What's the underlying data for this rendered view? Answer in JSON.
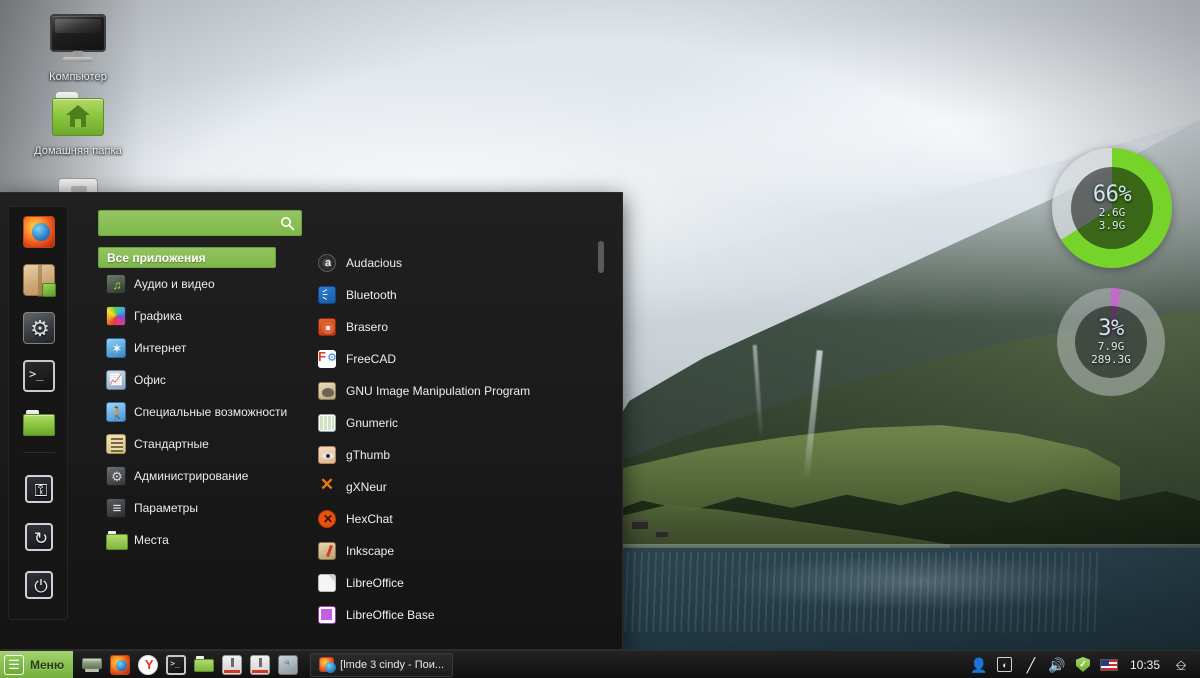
{
  "desktop": {
    "icons": [
      {
        "name": "computer",
        "label": "Компьютер",
        "icon": "monitor-icon"
      },
      {
        "name": "home-folder",
        "label": "Домашняя папка",
        "icon": "folder-home-icon"
      },
      {
        "name": "drive",
        "label": "",
        "icon": "drive-icon"
      }
    ],
    "gauges": [
      {
        "name": "memory-gauge",
        "percent": "66%",
        "used": "2.6G",
        "total": "3.9G",
        "value": 66,
        "color": "#76d329",
        "track": "#d8dcde"
      },
      {
        "name": "disk-gauge",
        "percent": "3%",
        "used": "7.9G",
        "total": "289.3G",
        "value": 3,
        "color": "#c06bc9",
        "track": "#b9bdbe"
      }
    ]
  },
  "menu": {
    "search": {
      "value": "",
      "placeholder": "",
      "icon": "search-icon"
    },
    "sidebar": [
      {
        "name": "firefox",
        "icon": "firefox-icon"
      },
      {
        "name": "software-manager",
        "icon": "package-icon"
      },
      {
        "name": "control-center",
        "icon": "cogs-icon"
      },
      {
        "name": "terminal",
        "icon": "terminal-icon"
      },
      {
        "name": "file-manager",
        "icon": "folder-icon"
      },
      {
        "name": "lock-screen",
        "icon": "lock-icon",
        "glyph": "⚿"
      },
      {
        "name": "logout",
        "icon": "logout-icon",
        "glyph": "↻"
      },
      {
        "name": "shutdown",
        "icon": "power-icon",
        "glyph": "⏻"
      }
    ],
    "categories": [
      {
        "label": "Все приложения",
        "icon": "all-apps-icon",
        "active": true,
        "icon_class": ""
      },
      {
        "label": "Аудио и видео",
        "icon": "audio-video-icon",
        "active": false,
        "icon_class": "ci-av"
      },
      {
        "label": "Графика",
        "icon": "graphics-icon",
        "active": false,
        "icon_class": "ci-gfx"
      },
      {
        "label": "Интернет",
        "icon": "internet-icon",
        "active": false,
        "icon_class": "ci-net"
      },
      {
        "label": "Офис",
        "icon": "office-icon",
        "active": false,
        "icon_class": "ci-off"
      },
      {
        "label": "Специальные возможности",
        "icon": "accessibility-icon",
        "active": false,
        "icon_class": "ci-acc"
      },
      {
        "label": "Стандартные",
        "icon": "accessories-icon",
        "active": false,
        "icon_class": "ci-std"
      },
      {
        "label": "Администрирование",
        "icon": "administration-icon",
        "active": false,
        "icon_class": "ci-adm"
      },
      {
        "label": "Параметры",
        "icon": "preferences-icon",
        "active": false,
        "icon_class": "ci-prm"
      },
      {
        "label": "Места",
        "icon": "places-icon",
        "active": false,
        "icon_class": "ci-plc"
      }
    ],
    "applications": [
      {
        "label": "Audacious",
        "icon": "audacious-icon",
        "icon_class": "ai-aud"
      },
      {
        "label": "Bluetooth",
        "icon": "bluetooth-icon",
        "icon_class": "ai-bt"
      },
      {
        "label": "Brasero",
        "icon": "brasero-icon",
        "icon_class": "ai-bra"
      },
      {
        "label": "FreeCAD",
        "icon": "freecad-icon",
        "icon_class": "ai-fcd"
      },
      {
        "label": "GNU Image Manipulation Program",
        "icon": "gimp-icon",
        "icon_class": "ai-gimp"
      },
      {
        "label": "Gnumeric",
        "icon": "gnumeric-icon",
        "icon_class": "ai-gnum"
      },
      {
        "label": "gThumb",
        "icon": "gthumb-icon",
        "icon_class": "ai-gth"
      },
      {
        "label": "gXNeur",
        "icon": "gxneur-icon",
        "icon_class": "ai-gxn"
      },
      {
        "label": "HexChat",
        "icon": "hexchat-icon",
        "icon_class": "ai-hex"
      },
      {
        "label": "Inkscape",
        "icon": "inkscape-icon",
        "icon_class": "ai-ink"
      },
      {
        "label": "LibreOffice",
        "icon": "libreoffice-icon",
        "icon_class": "ai-lo"
      },
      {
        "label": "LibreOffice Base",
        "icon": "libreoffice-base-icon",
        "icon_class": "ai-lob"
      }
    ],
    "accent_color": "#87c24f"
  },
  "taskbar": {
    "menu_button": {
      "label": "Меню",
      "icon": "linux-mint-logo"
    },
    "launchers": [
      {
        "name": "show-desktop",
        "icon": "show-desktop-icon",
        "class": "li-showdesk"
      },
      {
        "name": "firefox",
        "icon": "firefox-icon",
        "class": "li-ff"
      },
      {
        "name": "yandex-browser",
        "icon": "yandex-icon",
        "class": "li-yandex"
      },
      {
        "name": "terminal",
        "icon": "terminal-icon",
        "class": "li-term"
      },
      {
        "name": "file-manager",
        "icon": "folder-icon",
        "class": "li-folder"
      },
      {
        "name": "usb-drive-1",
        "icon": "usb-drive-icon",
        "class": "li-usb"
      },
      {
        "name": "usb-drive-2",
        "icon": "usb-drive-icon",
        "class": "li-usb"
      },
      {
        "name": "system-tool",
        "icon": "wrench-icon",
        "class": "li-tool"
      }
    ],
    "windows": [
      {
        "title": "[lmde 3 cindy - Пои...",
        "icon": "firefox-icon"
      }
    ],
    "tray": [
      {
        "name": "user-indicator",
        "icon": "user-icon",
        "glyph": "὆4"
      },
      {
        "name": "screenshot-indicator",
        "icon": "screenshot-icon",
        "glyph": "❑"
      },
      {
        "name": "brightness-indicator",
        "icon": "pen-icon",
        "glyph": "╱"
      },
      {
        "name": "volume-indicator",
        "icon": "speaker-icon",
        "glyph": "ὐA"
      },
      {
        "name": "update-manager",
        "icon": "shield-check-icon",
        "glyph": ""
      },
      {
        "name": "keyboard-layout",
        "icon": "flag-us-icon",
        "glyph": ""
      }
    ],
    "clock": "10:35",
    "workspace_switcher": {
      "name": "workspace-switcher",
      "icon": "windows-icon",
      "glyph": "❐"
    }
  }
}
